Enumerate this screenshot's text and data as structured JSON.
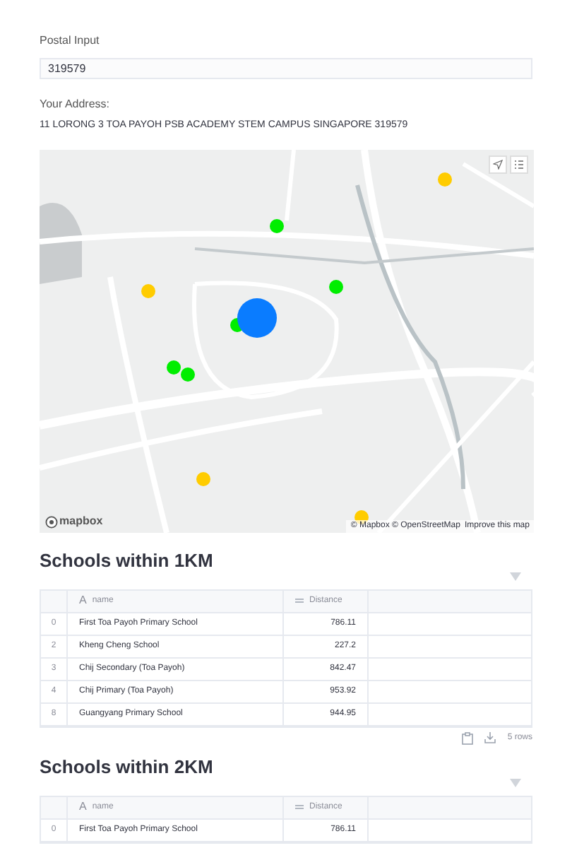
{
  "postal_input": {
    "label": "Postal Input",
    "value": "319579"
  },
  "address": {
    "label": "Your Address:",
    "value": "11 LORONG 3 TOA PAYOH PSB ACADEMY STEM CAMPUS SINGAPORE 319579"
  },
  "map": {
    "markers": [
      {
        "kind": "school",
        "color": "#ffcc00"
      },
      {
        "kind": "school",
        "color": "#00ee00"
      },
      {
        "kind": "school",
        "color": "#ffcc00"
      },
      {
        "kind": "school",
        "color": "#00ee00"
      },
      {
        "kind": "school",
        "color": "#00ee00"
      },
      {
        "kind": "home",
        "color": "#0a7cff"
      },
      {
        "kind": "school",
        "color": "#00ee00"
      },
      {
        "kind": "school",
        "color": "#00ee00"
      },
      {
        "kind": "school",
        "color": "#ffcc00"
      },
      {
        "kind": "school",
        "color": "#ffcc00"
      }
    ],
    "logo": "mapbox",
    "attribution": "© Mapbox © OpenStreetMap",
    "improve_link": "Improve this map"
  },
  "sections": [
    {
      "title": "Schools within 1KM",
      "name_type_icon": "A",
      "columns": [
        "name",
        "Distance"
      ],
      "rows": [
        {
          "index": "0",
          "name": "First Toa Payoh Primary School",
          "distance": "786.11"
        },
        {
          "index": "2",
          "name": "Kheng Cheng School",
          "distance": "227.2"
        },
        {
          "index": "3",
          "name": "Chij Secondary (Toa Payoh)",
          "distance": "842.47"
        },
        {
          "index": "4",
          "name": "Chij Primary (Toa Payoh)",
          "distance": "953.92"
        },
        {
          "index": "8",
          "name": "Guangyang Primary School",
          "distance": "944.95"
        }
      ],
      "footer": "5 rows"
    },
    {
      "title": "Schools within 2KM",
      "name_type_icon": "A",
      "columns": [
        "name",
        "Distance"
      ],
      "rows": [
        {
          "index": "0",
          "name": "First Toa Payoh Primary School",
          "distance": "786.11"
        }
      ]
    }
  ]
}
